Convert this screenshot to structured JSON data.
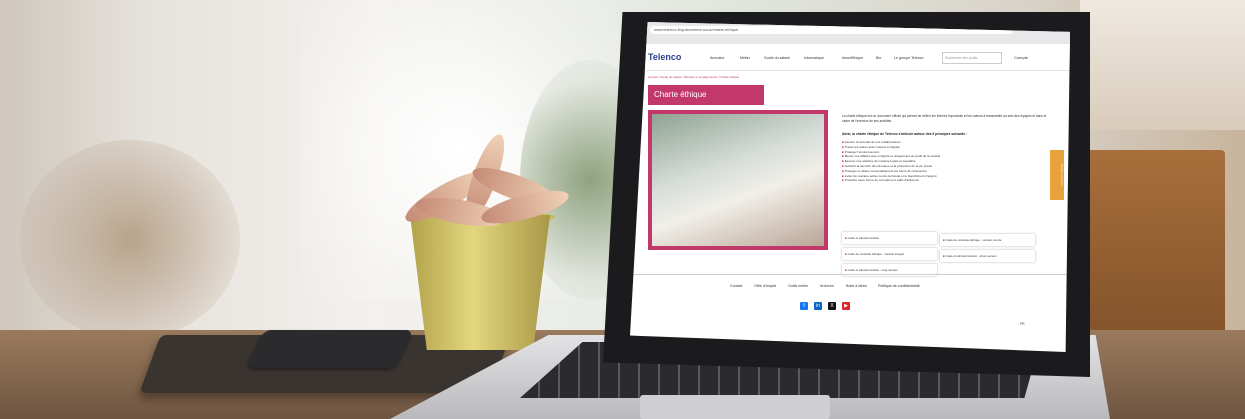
{
  "page": {
    "address": "www.telenco.fr/quisommes-nous/charte-ethique",
    "logo": "Telenco",
    "nav": [
      "Annuaire",
      "Métier",
      "Guide du salarié",
      "Informatique",
      "#monEthique",
      "Bio",
      "Le groupe Telenco",
      "Compte"
    ],
    "search_placeholder": "Recherche des profils",
    "breadcrumb": "Accueil / Guide du salarié / Éthique et engagements / Charte éthique",
    "title": "Charte éthique",
    "intro": "La charte éthique est un document officiel qui permet de définir les thèmes importants et les valeurs à transmettre au sein des équipes et dans le cadre de l'exercice de ses activités.",
    "intro_bold": "Ainsi, la charte éthique de Telenco s'articule autour des 9 principes suivants :",
    "principles": [
      "Assurer la sécurité de nos collaborateurs",
      "Traiter les autres avec respect et dignité",
      "Protéger l'environnement",
      "Mener nos affaires avec intégrité et uniquement au profit de la société",
      "Exercer nos activités de manière loyale et équitable",
      "Garantir la sécurité des données et la protection de la vie privée",
      "Protéger et utiliser convenablement les biens de l'entreprise",
      "Lutter de manière active contre la fraude et le blanchiment d'argent",
      "Proscrire toute forme de corruption et trafic d'influence"
    ],
    "documents": [
      "Code of ethical conduct",
      "Code de conduite éthique - version courte",
      "Code de conduite éthique - version longue",
      "Code of ethical conduct - short version",
      "Code of ethical conduct - long version"
    ],
    "footer_links": [
      "Contact",
      "Offre d'emploi",
      "Outils métier",
      "Archives",
      "Boite à idées",
      "Politique de confidentialité"
    ],
    "social": [
      "f",
      "in",
      "X",
      "▶"
    ],
    "feedback": "Donner son avis",
    "lang": "FR"
  },
  "colors": {
    "accent": "#c2386b",
    "logo_blue": "#2c3e8f",
    "feedback_tab": "#e8a23b"
  }
}
